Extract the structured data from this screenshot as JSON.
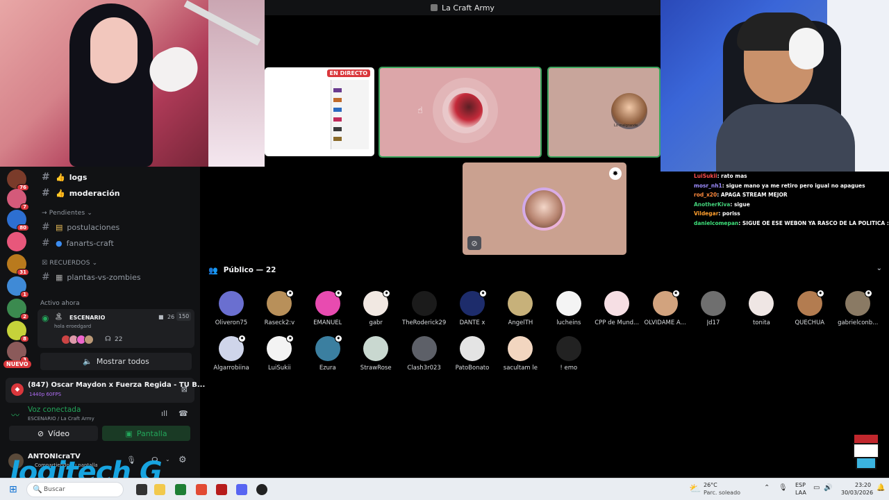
{
  "stage": {
    "title": "La Craft Army",
    "live_badge": "EN DIRECTO",
    "tile3_caption": "Lo malgrande"
  },
  "channels": {
    "logs": "logs",
    "moderacion": "moderación",
    "cat_pendientes": "→ Pendientes ⌄",
    "postulaciones": "postulaciones",
    "fanarts": "fanarts-craft",
    "cat_recuerdos": "☒ RECUERDOS ⌄",
    "plantas": "plantas-vs-zombies",
    "active_now": "Activo ahora",
    "stage_label": "ESCENARIO",
    "stage_sub": "hola eroedgard",
    "stage_video_count": "26",
    "stage_listeners": "150",
    "listening_count": "22",
    "show_all": "Mostrar todos"
  },
  "servers": [
    {
      "badge": "76",
      "color": "#7a3b2a"
    },
    {
      "badge": "7",
      "color": "#d45a7a"
    },
    {
      "badge": "80",
      "color": "#2d6fd1"
    },
    {
      "badge": "",
      "color": "#e8577b"
    },
    {
      "badge": "31",
      "color": "#b97a1d"
    },
    {
      "badge": "1",
      "color": "#3f8ad6"
    },
    {
      "badge": "2",
      "color": "#3b8a4f"
    },
    {
      "badge": "8",
      "color": "#c6d23a"
    },
    {
      "badge": "3",
      "color": "#8b5a5a"
    }
  ],
  "nuevo": "NUEVO",
  "panel": {
    "music_title": "(847) Oscar Maydon x Fuerza Regida - TU B...",
    "music_sub": "1440p 60FPS",
    "voice_status": "Voz conectada",
    "voice_sub": "ESCENARIO / La Craft Army",
    "video_label": "Vídeo",
    "screen_label": "Pantalla",
    "user_name": "ANTONIcraTV",
    "user_status": "Compartiendo su pantalla"
  },
  "chat": [
    {
      "user": "LuiSukii",
      "color": "#ff4d4d",
      "text": ": rato mas"
    },
    {
      "user": "mosr_nh1",
      "color": "#9d8cff",
      "text": ": sigue mano ya me retiro pero igual no apagues"
    },
    {
      "user": "rod_x20",
      "color": "#ff8a3d",
      "text": ": APAGA STREAM MEJOR"
    },
    {
      "user": "AnotherKiva",
      "color": "#43d17a",
      "text": ": sigue"
    },
    {
      "user": "Vildegar",
      "color": "#ff9f2e",
      "text": ": poriss"
    },
    {
      "user": "danielcomepan",
      "color": "#3ee07a",
      "text": ": SIGUE OE ESE WEBON YA RASCO DE LA POLITICA :V"
    }
  ],
  "public": {
    "header": "Público — 22",
    "members": [
      {
        "name": "Oliveron75",
        "color": "#6a6fd0",
        "badge": false
      },
      {
        "name": "Raseck2:v",
        "color": "#b8905a",
        "badge": true
      },
      {
        "name": "EMANUEL",
        "color": "#e84bb0",
        "badge": true
      },
      {
        "name": "gabr",
        "color": "#f1e8e2",
        "badge": true
      },
      {
        "name": "TheRoderick29",
        "color": "#1b1b1b",
        "badge": false
      },
      {
        "name": "DANTE x",
        "color": "#1d2c6b",
        "badge": true
      },
      {
        "name": "AngelTH",
        "color": "#c7b17a",
        "badge": false
      },
      {
        "name": "lucheins",
        "color": "#f4f4f4",
        "badge": false
      },
      {
        "name": "CPP de Mund...",
        "color": "#f6dfe4",
        "badge": false
      },
      {
        "name": "OLVIDAME A...",
        "color": "#d2a37e",
        "badge": true
      },
      {
        "name": "Jd17",
        "color": "#6f6f6f",
        "badge": false
      },
      {
        "name": "tonita",
        "color": "#efe6e4",
        "badge": false
      },
      {
        "name": "QUECHUA",
        "color": "#b37c50",
        "badge": true
      },
      {
        "name": "gabrielconb...",
        "color": "#8a7a64",
        "badge": true
      },
      {
        "name": "Algarrobiina",
        "color": "#cfd5ea",
        "badge": true
      },
      {
        "name": "LuiSukii",
        "color": "#f3f3f3",
        "badge": true
      },
      {
        "name": "Ezura",
        "color": "#3b7fa0",
        "badge": true
      },
      {
        "name": "StrawRose",
        "color": "#c9d8d0",
        "badge": false
      },
      {
        "name": "Clash3r023",
        "color": "#5d6068",
        "badge": false
      },
      {
        "name": "PatoBonato",
        "color": "#e4e4e4",
        "badge": false
      },
      {
        "name": "sacultam le",
        "color": "#f2d6c0",
        "badge": false
      },
      {
        "name": "! emo",
        "color": "#222222",
        "badge": false
      }
    ]
  },
  "taskbar": {
    "search": "Buscar",
    "weather_temp": "26°C",
    "weather_desc": "Parc. soleado",
    "lang1": "ESP",
    "lang2": "LAA",
    "time": "23:20",
    "date": "30/03/2026"
  },
  "overlay": {
    "logo": "logitech G"
  }
}
